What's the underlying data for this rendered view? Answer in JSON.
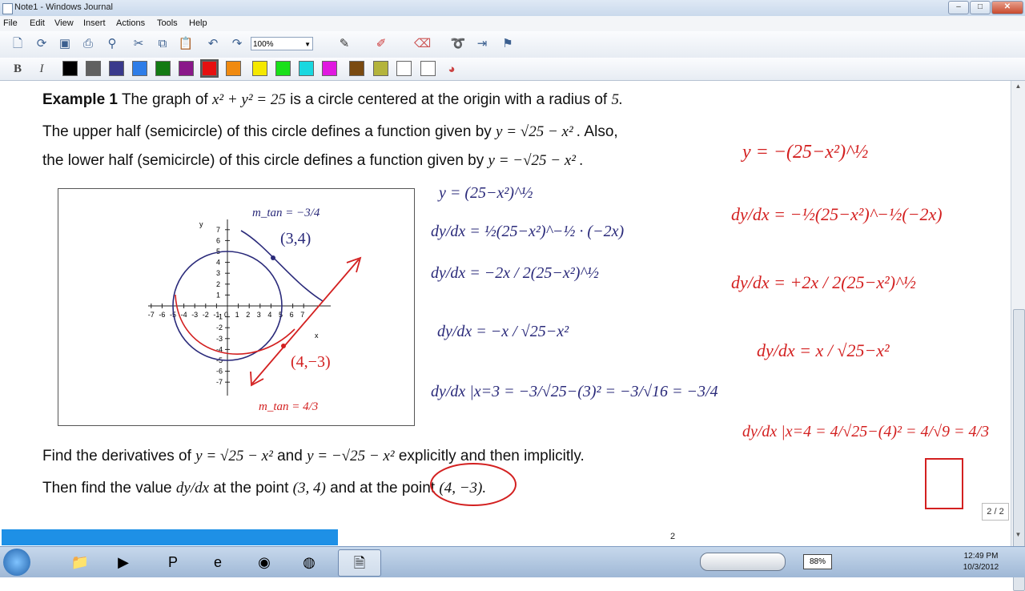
{
  "window": {
    "title": "Note1 - Windows Journal"
  },
  "menu": [
    "File",
    "Edit",
    "View",
    "Insert",
    "Actions",
    "Tools",
    "Help"
  ],
  "toolbar": {
    "zoom": "100%"
  },
  "colors": [
    "#000000",
    "#606060",
    "#3a3a8c",
    "#2e7de8",
    "#137a13",
    "#8a188a",
    "#e61010",
    "#f08a10",
    "#f5e800",
    "#19e019",
    "#19d8e0",
    "#e019e0",
    "#7a4a10",
    "#b4b43c",
    "#ffffff",
    "#ffffff"
  ],
  "text": {
    "example_label": "Example 1",
    "line1_a": "The graph of",
    "line1_eq": "x² + y² = 25",
    "line1_b": "is a circle centered at the origin with a radius of",
    "line1_r": "5.",
    "line2_a": "The upper half (semicircle) of this circle defines a function given by",
    "line2_eq": "y = √25 − x² .",
    "line2_b": "Also,",
    "line3_a": "the lower half (semicircle) of this circle defines a function given by",
    "line3_eq": "y = −√25 − x² .",
    "q1_a": "Find the derivatives of",
    "q1_eq1": "y = √25 − x²",
    "q1_and": "and",
    "q1_eq2": "y = −√25 − x²",
    "q1_b": "explicitly and then implicitly.",
    "q2_a": "Then find the value",
    "q2_frac": "dy/dx",
    "q2_b": "at the point",
    "q2_p1": "(3, 4)",
    "q2_c": "and at the point",
    "q2_p2": "(4, −3)."
  },
  "graph": {
    "ylabel": "y",
    "xlabel": "x",
    "x_ticks": [
      "-7",
      "-6",
      "-5",
      "-4",
      "-3",
      "-2",
      "-1",
      "0",
      "1",
      "2",
      "3",
      "4",
      "5",
      "6",
      "7"
    ],
    "y_ticks": [
      "7",
      "6",
      "5",
      "4",
      "3",
      "2",
      "1",
      "-1",
      "-2",
      "-3",
      "-4",
      "-5",
      "-6",
      "-7"
    ]
  },
  "handwriting": {
    "mtan_top": "m_tan = −3/4",
    "pt1": "(3,4)",
    "pt2": "(4,−3)",
    "mtan_bot": "m_tan = 4/3",
    "mid": [
      "y = (25−x²)^½",
      "dy/dx = ½(25−x²)^−½ · (−2x)",
      "dy/dx = −2x / 2(25−x²)^½",
      "dy/dx = −x / √25−x²",
      "dy/dx |x=3 = −3/√25−(3)² = −3/√16 = −3/4"
    ],
    "right": [
      "y = −(25−x²)^½",
      "dy/dx = −½(25−x²)^−½(−2x)",
      "dy/dx = +2x / 2(25−x²)^½",
      "dy/dx = x / √25−x²",
      "dy/dx |x=4 = 4/√25−(4)² = 4/√9 = 4/3"
    ]
  },
  "status": {
    "page_box": "2 / 2",
    "page_number": "2"
  },
  "taskbar": {
    "battery": "88%",
    "time": "12:49 PM",
    "date": "10/3/2012"
  }
}
